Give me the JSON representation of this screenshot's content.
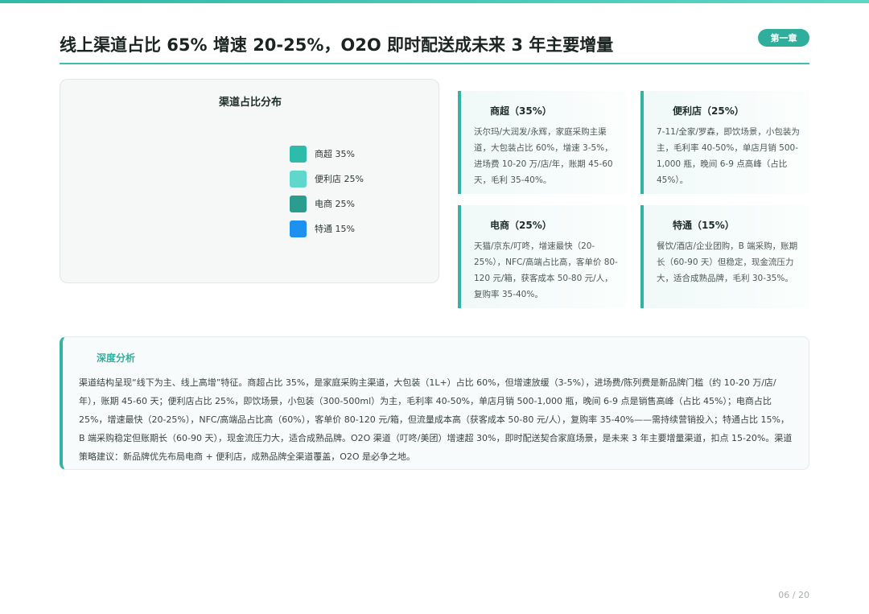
{
  "header": {
    "title": "线上渠道占比 65% 增速 20-25%，O2O 即时配送成未来 3 年主要增量",
    "chapter": "第一章"
  },
  "chart_data": {
    "type": "pie",
    "title": "渠道占比分布",
    "categories": [
      "商超",
      "便利店",
      "电商",
      "特通"
    ],
    "values": [
      35,
      25,
      25,
      15
    ],
    "legend": [
      {
        "label": "商超 35%",
        "color": "#2dbbaa"
      },
      {
        "label": "便利店 25%",
        "color": "#5fd8cb"
      },
      {
        "label": "电商 25%",
        "color": "#2a9d8f"
      },
      {
        "label": "特通 15%",
        "color": "#1e90f0"
      }
    ],
    "legend_position": "right"
  },
  "cards": [
    {
      "title": "商超（35%）",
      "text": "沃尔玛/大润发/永辉，家庭采购主渠道，大包装占比 60%，增速 3-5%，进场费 10-20 万/店/年，账期 45-60 天，毛利 35-40%。"
    },
    {
      "title": "便利店（25%）",
      "text": "7-11/全家/罗森，即饮场景，小包装为主，毛利率 40-50%，单店月销 500-1,000 瓶，晚间 6-9 点高峰（占比 45%）。"
    },
    {
      "title": "电商（25%）",
      "text": "天猫/京东/叮咚，增速最快（20-25%），NFC/高端占比高，客单价 80-120 元/箱，获客成本 50-80 元/人，复购率 35-40%。"
    },
    {
      "title": "特通（15%）",
      "text": "餐饮/酒店/企业团购，B 端采购，账期长（60-90 天）但稳定，现金流压力大，适合成熟品牌，毛利 30-35%。"
    }
  ],
  "analysis": {
    "title": "深度分析",
    "text": "渠道结构呈现“线下为主、线上高增”特征。商超占比 35%，是家庭采购主渠道，大包装（1L+）占比 60%，但增速放缓（3-5%），进场费/陈列费是新品牌门槛（约 10-20 万/店/年），账期 45-60 天；便利店占比 25%，即饮场景，小包装（300-500ml）为主，毛利率 40-50%，单店月销 500-1,000 瓶，晚间 6-9 点是销售高峰（占比 45%）；电商占比 25%，增速最快（20-25%），NFC/高端品占比高（60%），客单价 80-120 元/箱，但流量成本高（获客成本 50-80 元/人），复购率 35-40%——需持续营销投入；特通占比 15%，B 端采购稳定但账期长（60-90 天），现金流压力大，适合成熟品牌。O2O 渠道（叮咚/美团）增速超 30%，即时配送契合家庭场景，是未来 3 年主要增量渠道，扣点 15-20%。渠道策略建议：新品牌优先布局电商 + 便利店，成熟品牌全渠道覆盖，O2O 是必争之地。"
  },
  "footer": {
    "page": "06 / 20"
  }
}
